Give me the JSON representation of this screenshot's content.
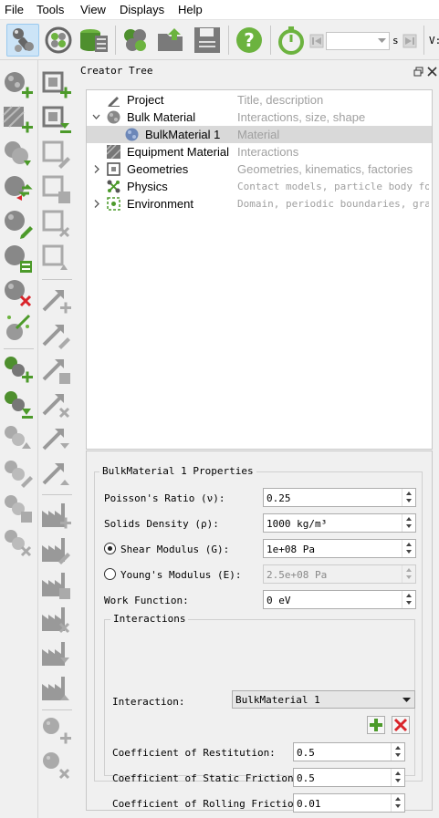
{
  "menubar": {
    "items": [
      {
        "label": "File"
      },
      {
        "label": "Tools"
      },
      {
        "label": "View"
      },
      {
        "label": "Displays"
      },
      {
        "label": "Help"
      }
    ]
  },
  "toolbar": {
    "time_unit": "s",
    "overflow_text": "V:"
  },
  "dock": {
    "title": "Creator Tree"
  },
  "tree": {
    "rows": [
      {
        "name": "Project",
        "description": "Title, description"
      },
      {
        "name": "Bulk Material",
        "description": "Interactions, size, shape"
      },
      {
        "name": "BulkMaterial 1",
        "description": "Material"
      },
      {
        "name": "Equipment Material",
        "description": "Interactions"
      },
      {
        "name": "Geometries",
        "description": "Geometries, kinematics, factories"
      },
      {
        "name": "Physics",
        "description": "Contact models, particle body for…"
      },
      {
        "name": "Environment",
        "description": "Domain, periodic boundaries, gra…"
      }
    ]
  },
  "properties": {
    "title": "BulkMaterial 1 Properties",
    "poisson": {
      "label": "Poisson's Ratio (ν):",
      "value": "0.25"
    },
    "density": {
      "label": "Solids Density (ρ):",
      "value": "1000 kg/m³"
    },
    "shear": {
      "label": "Shear Modulus (G):",
      "value": "1e+08 Pa",
      "selected": true
    },
    "youngs": {
      "label": "Young's Modulus (E):",
      "value": "2.5e+08 Pa",
      "selected": false
    },
    "work_function": {
      "label": "Work Function:",
      "value": "0 eV"
    }
  },
  "interactions": {
    "title": "Interactions",
    "interaction_label": "Interaction:",
    "interaction_value": "BulkMaterial 1",
    "restitution": {
      "label": "Coefficient of Restitution:",
      "value": "0.5"
    },
    "static_friction": {
      "label": "Coefficient of Static Friction:",
      "value": "0.5"
    },
    "rolling_friction": {
      "label": "Coefficient of Rolling Friction:",
      "value": "0.01"
    }
  },
  "colors": {
    "green_add": "#4c9a2a",
    "red_delete": "#d9242a",
    "help_green": "#6cb33f",
    "selection": "#cce4f7"
  }
}
